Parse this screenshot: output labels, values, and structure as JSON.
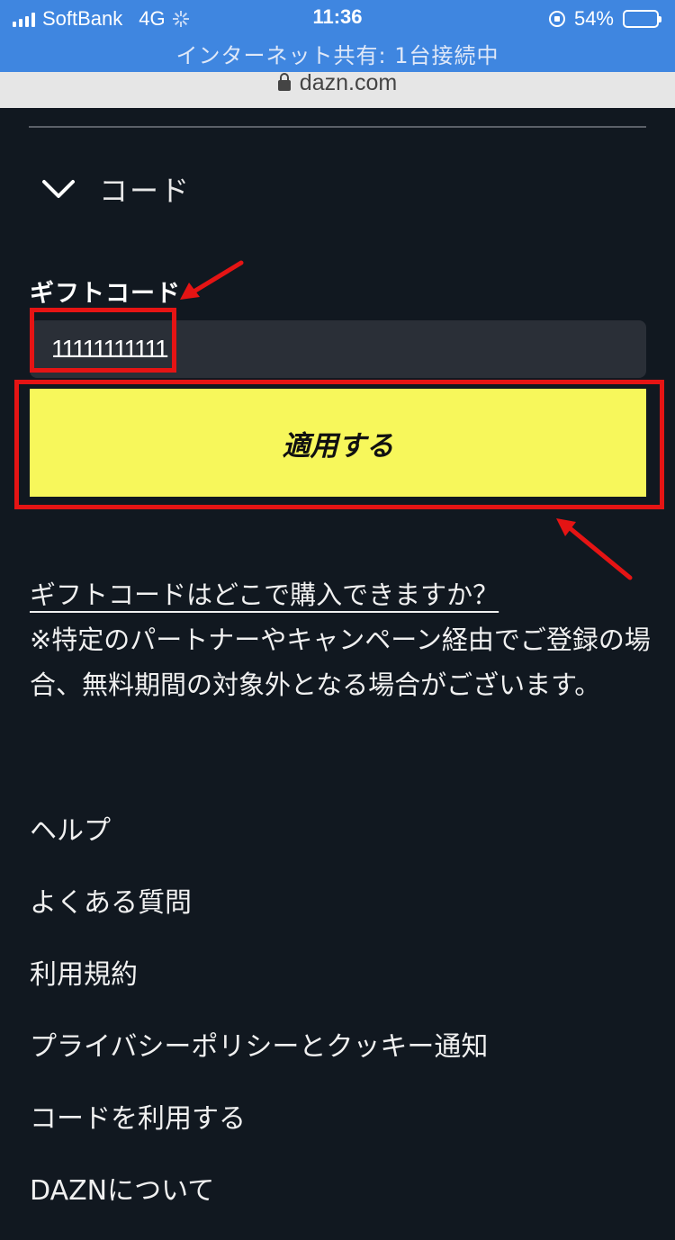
{
  "status_bar": {
    "carrier": "SoftBank",
    "network": "4G",
    "time": "11:36",
    "battery": "54%",
    "battery_level": 0.54,
    "tethering": "インターネット共有: 1台接続中"
  },
  "browser": {
    "url": "dazn.com"
  },
  "code_section": {
    "toggle_label": "コード",
    "gift_code_label": "ギフトコード",
    "gift_code_value": "11111111111",
    "apply_button_label": "適用する"
  },
  "info": {
    "purchase_link": "ギフトコードはどこで購入できますか？",
    "note": "※特定のパートナーやキャンペーン経由でご登録の場合、無料期間の対象外となる場合がございます。"
  },
  "footer": {
    "links": [
      "ヘルプ",
      "よくある質問",
      "利用規約",
      "プライバシーポリシーとクッキー通知",
      "コードを利用する",
      "DAZNについて"
    ]
  },
  "colors": {
    "background": "#111820",
    "status_bar": "#3f86e0",
    "apply_button": "#f7f75b",
    "annotation": "#e51414",
    "input": "#2a2f37"
  },
  "icons": [
    "signal-icon",
    "loading-icon",
    "rotation-lock-icon",
    "battery-icon",
    "lock-icon",
    "chevron-down-icon"
  ]
}
